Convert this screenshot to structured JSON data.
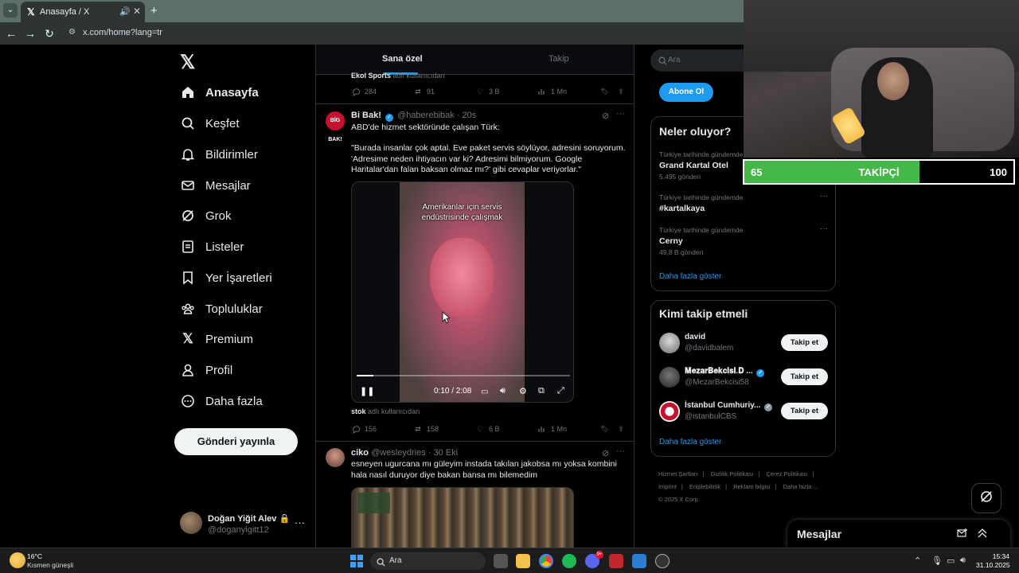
{
  "browser": {
    "tab_title": "Anasayfa / X",
    "url": "x.com/home?lang=tr"
  },
  "sidebar": {
    "items": [
      {
        "label": "Anasayfa",
        "icon": "home-icon",
        "active": true
      },
      {
        "label": "Keşfet",
        "icon": "search-icon"
      },
      {
        "label": "Bildirimler",
        "icon": "bell-icon"
      },
      {
        "label": "Mesajlar",
        "icon": "mail-icon"
      },
      {
        "label": "Grok",
        "icon": "grok-icon"
      },
      {
        "label": "Listeler",
        "icon": "list-icon"
      },
      {
        "label": "Yer İşaretleri",
        "icon": "bookmark-icon"
      },
      {
        "label": "Topluluklar",
        "icon": "communities-icon"
      },
      {
        "label": "Premium",
        "icon": "x-logo-icon"
      },
      {
        "label": "Profil",
        "icon": "person-icon"
      },
      {
        "label": "Daha fazla",
        "icon": "more-circle-icon"
      }
    ],
    "post_button": "Gönderi yayınla",
    "profile": {
      "name": "Doğan Yiğit Alev",
      "handle": "@doganyigitt12"
    }
  },
  "feed": {
    "tabs": [
      "Sana özel",
      "Takip"
    ],
    "prev_tweet": {
      "fragment_name": "Ekol Sports",
      "fragment_rest": "adlı kullanıcıdan",
      "replies": "284",
      "reposts": "91",
      "likes": "3 B",
      "views": "1 Mn"
    },
    "tweet1": {
      "name": "Bi Bak!",
      "handle": "@haberebibak",
      "time": "· 20s",
      "avatar_text": "BİG BAK!",
      "text_1": "ABD'de hizmet sektöründe çalışan Türk:",
      "text_2": "\"Burada insanlar çok aptal. Eve paket servis söylüyor, adresini soruyorum. 'Adresime neden ihtiyacın var ki? Adresimi bilmiyorum. Google Haritalar'dan falan baksan olmaz mı?' gibi cevaplar veriyorlar.\"",
      "video_caption": "Amerikanlar için servis endüstrisinde çalışmak",
      "video_time": "0:10 / 2:08",
      "video_progress": 0.08,
      "source_name": "stok",
      "source_rest": "adlı kullanıcıdan",
      "replies": "156",
      "reposts": "158",
      "likes": "6 B",
      "views": "1 Mn"
    },
    "tweet2": {
      "name": "ciko",
      "handle": "@wesleydries",
      "time": "· 30 Eki",
      "text": "esneyen ugurcana mı güleyim instada takılan jakobsa mı yoksa kombini hala nasıl duruyor diye bakan bansa mı bilemedim"
    }
  },
  "right": {
    "search_placeholder": "Ara",
    "subscribe_button": "Abone Ol",
    "trends_title": "Neler oluyor?",
    "trends": [
      {
        "context": "Türkiye tarihinde gündemde",
        "name": "Grand Kartal Otel",
        "count": "5.495 gönderi"
      },
      {
        "context": "Türkiye tarihinde gündemde",
        "name": "#kartalkaya",
        "count": ""
      },
      {
        "context": "Türkiye tarihinde gündemde",
        "name": "Cerny",
        "count": "49,8 B gönderi"
      }
    ],
    "trends_more": "Daha fazla göster",
    "wtf_title": "Kimi takip etmeli",
    "wtf": [
      {
        "name": "david",
        "handle": "@davidbalem",
        "verified": false,
        "button": "Takip et"
      },
      {
        "name": "𝐌𝐞𝐳𝐚𝐫𝐁𝐞𝐤𝐜𝐢𝐬𝐢.𝐃 ...",
        "handle": "@MezarBekcisi58",
        "verified": true,
        "button": "Takip et"
      },
      {
        "name": "İstanbul Cumhuriy...",
        "handle": "@istanbulCBS",
        "verified": true,
        "button": "Takip et"
      }
    ],
    "wtf_more": "Daha fazla göster",
    "footer": [
      "Hizmet Şartları",
      "|",
      "Gizlilik Politikası",
      "|",
      "Çerez Politikası",
      "|",
      "İmprint",
      "|",
      "Erişilebilirlik",
      "|",
      "Reklam bilgisi",
      "|",
      "Daha fazla ...",
      "© 2025 X Corp."
    ],
    "messages_title": "Mesajlar"
  },
  "overlay": {
    "follower_current": "65",
    "follower_label": "TAKİPÇİ",
    "follower_goal": "100",
    "follower_fraction": 0.65
  },
  "taskbar": {
    "weather_temp": "16°C",
    "weather_desc": "Kısmen güneşli",
    "search_text": "Ara",
    "discord_badge": "9+",
    "time": "15:34",
    "date": "31.10.2025"
  },
  "colors": {
    "accent": "#1d9bf0",
    "follower_bar": "#44b848"
  }
}
